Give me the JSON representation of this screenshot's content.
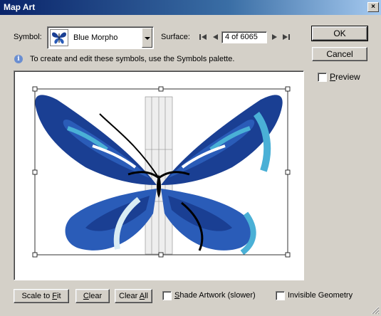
{
  "window": {
    "title": "Map Art",
    "close_glyph": "×"
  },
  "symbol": {
    "label": "Symbol:",
    "selected": "Blue Morpho",
    "thumb_icon": "butterfly-icon"
  },
  "surface": {
    "label": "Surface:",
    "value": "4 of 6065"
  },
  "info": {
    "text": "To create and edit these symbols, use the Symbols palette.",
    "icon": "info-icon"
  },
  "buttons": {
    "ok": "OK",
    "cancel": "Cancel",
    "scale_to_fit": {
      "pre": "Scale to ",
      "ul": "F",
      "post": "it"
    },
    "clear": {
      "pre": "",
      "ul": "C",
      "post": "lear"
    },
    "clear_all": {
      "pre": "Clear ",
      "ul": "A",
      "post": "ll"
    }
  },
  "checkboxes": {
    "preview": {
      "pre": "",
      "ul": "P",
      "post": "review",
      "checked": false
    },
    "shade_artwork": {
      "pre": "",
      "ul": "S",
      "post": "hade Artwork (slower)",
      "checked": false
    },
    "invisible_geometry": {
      "label": "Invisible Geometry",
      "checked": false
    }
  },
  "colors": {
    "wing_dark": "#1a3f93",
    "wing_mid": "#2a5cb8",
    "wing_light": "#4ab0d6",
    "window_bg": "#d4d0c8"
  }
}
